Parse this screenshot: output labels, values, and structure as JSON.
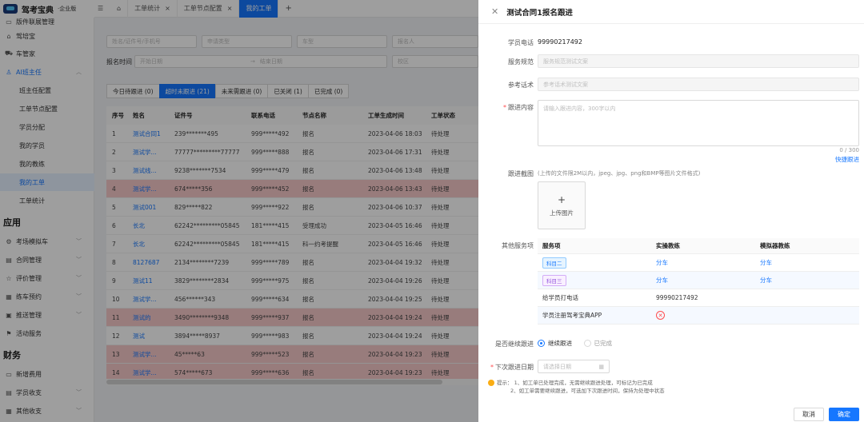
{
  "brand": {
    "name": "驾考宝典",
    "edition": "·企业版"
  },
  "sidebar": {
    "items": [
      {
        "label": "版件联展管理",
        "icon": "doc-icon"
      },
      {
        "label": "驾培宝",
        "icon": "car-icon"
      },
      {
        "label": "车管家",
        "icon": "car-front-icon"
      },
      {
        "label": "AI班主任",
        "icon": "user-icon"
      },
      {
        "label": "班主任配置"
      },
      {
        "label": "工单节点配置"
      },
      {
        "label": "学员分配"
      },
      {
        "label": "我的学员"
      },
      {
        "label": "我的教练"
      },
      {
        "label": "我的工单"
      },
      {
        "label": "工单统计"
      }
    ],
    "section_apply": "应用",
    "apply_items": [
      {
        "label": "考场模拟车",
        "icon": "gear-icon"
      },
      {
        "label": "合同管理",
        "icon": "contract-icon"
      },
      {
        "label": "评价管理",
        "icon": "star-icon"
      },
      {
        "label": "练车预约",
        "icon": "calendar-icon"
      },
      {
        "label": "推送管理",
        "icon": "push-icon"
      },
      {
        "label": "活动服务",
        "icon": "flag-icon"
      }
    ],
    "section_finance": "财务",
    "finance_items": [
      {
        "label": "新增费用",
        "icon": "add-fee-icon"
      },
      {
        "label": "学员收支",
        "icon": "wallet-icon"
      },
      {
        "label": "其他收支",
        "icon": "money-icon"
      }
    ]
  },
  "tabs": [
    {
      "label": "工单统计"
    },
    {
      "label": "工单节点配置"
    },
    {
      "label": "我的工单"
    }
  ],
  "filters": {
    "name_placeholder": "姓名/证件号/手机号",
    "type_placeholder": "申请类型",
    "vehicle_placeholder": "车型",
    "registrant_placeholder": "报名人",
    "date_label": "报名时间",
    "start_placeholder": "开始日期",
    "end_placeholder": "结束日期",
    "campus_placeholder": "校区"
  },
  "status_tabs": [
    {
      "label": "今日待跟进 (0)"
    },
    {
      "label": "超时未跟进 (21)"
    },
    {
      "label": "未来需跟进 (0)"
    },
    {
      "label": "已关闭 (1)"
    },
    {
      "label": "已完成 (0)"
    }
  ],
  "table": {
    "headers": [
      "序号",
      "姓名",
      "证件号",
      "联系电话",
      "节点名称",
      "工单生成时间",
      "工单状态"
    ],
    "rows": [
      {
        "no": "1",
        "name": "测试合同1",
        "id": "239*******495",
        "phone": "999*****492",
        "node": "报名",
        "time": "2023-04-06 18:03",
        "status": "待处理",
        "hl": false
      },
      {
        "no": "2",
        "name": "测试学...",
        "id": "77777*********77777",
        "phone": "999*****888",
        "node": "报名",
        "time": "2023-04-06 17:31",
        "status": "待处理",
        "hl": false
      },
      {
        "no": "3",
        "name": "测试线...",
        "id": "9238*******7534",
        "phone": "999*****479",
        "node": "报名",
        "time": "2023-04-06 13:48",
        "status": "待处理",
        "hl": false
      },
      {
        "no": "4",
        "name": "测试学...",
        "id": "674*****356",
        "phone": "999*****452",
        "node": "报名",
        "time": "2023-04-06 13:43",
        "status": "待处理",
        "hl": true
      },
      {
        "no": "5",
        "name": "测试001",
        "id": "829*****822",
        "phone": "999*****922",
        "node": "报名",
        "time": "2023-04-06 10:37",
        "status": "待处理",
        "hl": false
      },
      {
        "no": "6",
        "name": "长北",
        "id": "62242*********05845",
        "phone": "181*****415",
        "node": "受理成功",
        "time": "2023-04-05 16:46",
        "status": "待处理",
        "hl": false
      },
      {
        "no": "7",
        "name": "长北",
        "id": "62242*********05845",
        "phone": "181*****415",
        "node": "科一约考提醒",
        "time": "2023-04-05 16:46",
        "status": "待处理",
        "hl": false
      },
      {
        "no": "8",
        "name": "8127687",
        "id": "2134********7239",
        "phone": "999*****789",
        "node": "报名",
        "time": "2023-04-04 19:32",
        "status": "待处理",
        "hl": false
      },
      {
        "no": "9",
        "name": "测试11",
        "id": "3829********2834",
        "phone": "999*****975",
        "node": "报名",
        "time": "2023-04-04 19:26",
        "status": "待处理",
        "hl": false
      },
      {
        "no": "10",
        "name": "测试学...",
        "id": "456******343",
        "phone": "999*****634",
        "node": "报名",
        "time": "2023-04-04 19:25",
        "status": "待处理",
        "hl": false
      },
      {
        "no": "11",
        "name": "测试的",
        "id": "3490********9348",
        "phone": "999*****937",
        "node": "报名",
        "time": "2023-04-04 19:24",
        "status": "待处理",
        "hl": true
      },
      {
        "no": "12",
        "name": "测试",
        "id": "3894*****8937",
        "phone": "999*****983",
        "node": "报名",
        "time": "2023-04-04 19:24",
        "status": "待处理",
        "hl": false
      },
      {
        "no": "13",
        "name": "测试学...",
        "id": "45*****63",
        "phone": "999*****523",
        "node": "报名",
        "time": "2023-04-04 19:23",
        "status": "待处理",
        "hl": true
      },
      {
        "no": "14",
        "name": "测试学...",
        "id": "574*****673",
        "phone": "999*****636",
        "node": "报名",
        "time": "2023-04-04 19:23",
        "status": "待处理",
        "hl": true
      }
    ]
  },
  "drawer": {
    "title": "测试合同1报名跟进",
    "phone_label": "学员电话",
    "phone_value": "99990217492",
    "norm_label": "服务规范",
    "norm_placeholder": "服务规范测试文案",
    "script_label": "参考话术",
    "script_placeholder": "参考话术测试文案",
    "content_label": "跟进内容",
    "content_placeholder": "请输入跟进内容，300字以内",
    "counter": "0 / 300",
    "quick_link": "快捷跟进",
    "screenshot_label": "跟进截图",
    "screenshot_hint": "(上传的文件限2M以内，jpeg、jpg、png和BMP等图片文件格式)",
    "upload_plus": "+",
    "upload_label": "上传图片",
    "other_label": "其他服务项",
    "svc_headers": [
      "服务项",
      "实操教练",
      "模拟器教练"
    ],
    "svc_rows": [
      {
        "item": "科目二",
        "coach": "分车",
        "sim": "分车"
      },
      {
        "item": "科目三",
        "coach": "分车",
        "sim": "分车"
      },
      {
        "item": "给学员打电话",
        "coach": "99990217492",
        "sim": ""
      },
      {
        "item": "学员注册驾考宝典APP",
        "coach": "",
        "sim": ""
      }
    ],
    "continue_label": "是否继续跟进",
    "opt_continue": "继续跟进",
    "opt_done": "已完成",
    "next_label": "下次跟进日期",
    "date_placeholder": "请选择日期",
    "tip_title": "提示：",
    "tip1": "1、如工单已处理完成，无需继续跟进处理，可标记为已完成",
    "tip2": "2、如工单需要继续跟进，可选加下次跟进时间，保持为处理中状态",
    "cancel": "取消",
    "confirm": "确定"
  }
}
